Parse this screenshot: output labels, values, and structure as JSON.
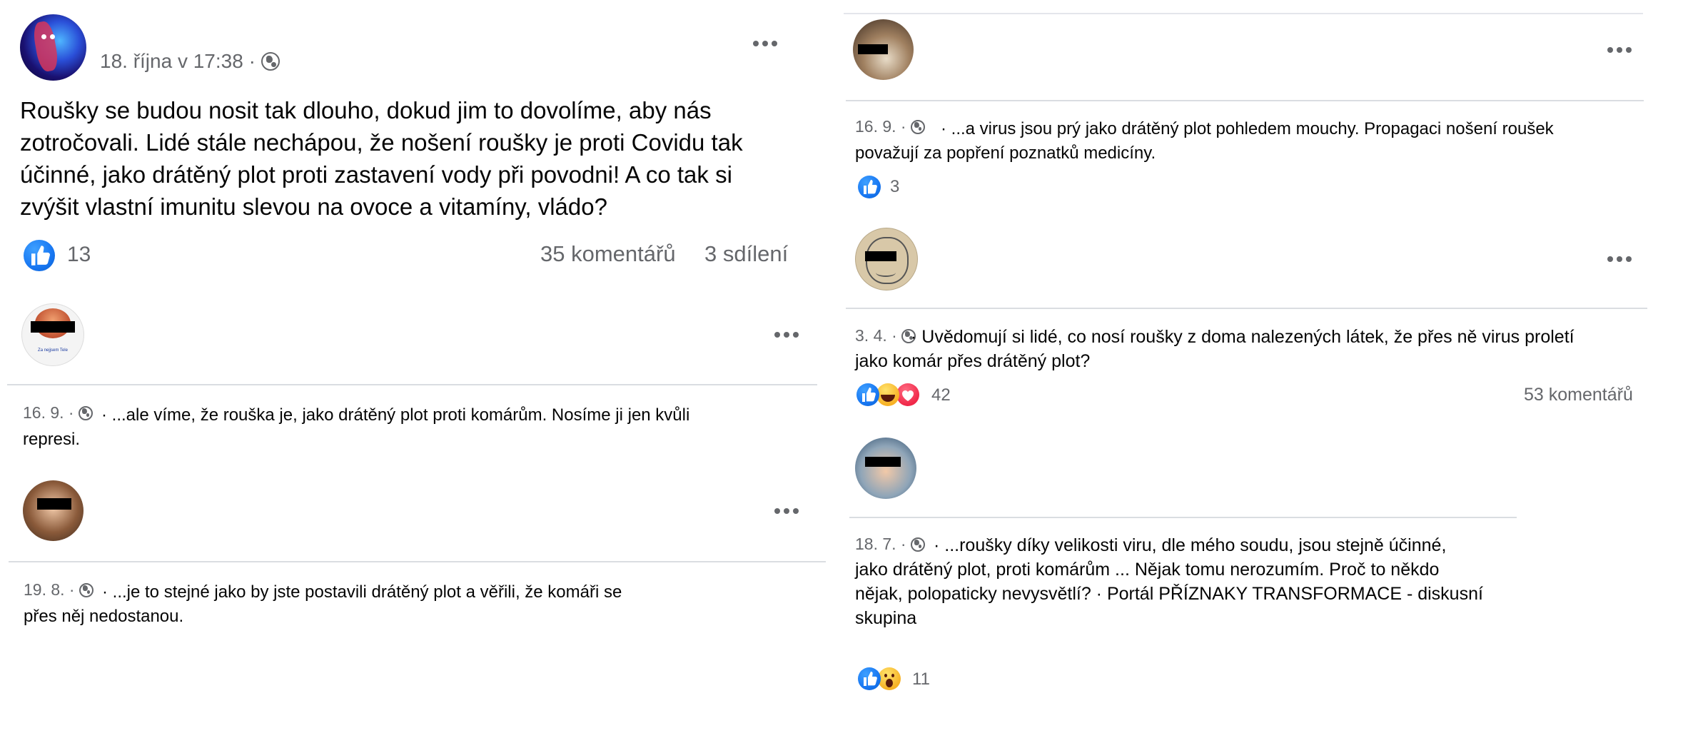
{
  "main_post": {
    "timestamp": "18. října v 17:38 ·",
    "text_lines": [
      "Roušky se budou nosit tak dlouho, dokud  jim to dovolíme, aby nás",
      "zotročovali. Lidé stále nechápou, že nošení roušky je proti Covidu tak",
      "účinné, jako drátěný plot proti zastavení vody při povodni! A co tak si",
      "zvýšit vlastní imunitu slevou na ovoce a vitamíny, vládo?"
    ],
    "likes": "13",
    "comments": "35 komentářů",
    "shares": "3 sdílení",
    "privacy_icon": "globe-icon",
    "more_icon": "more-dots-icon"
  },
  "left_posts": [
    {
      "avatar_caption": "Za nejjsem Tele",
      "timestamp": "16. 9. ·",
      "text_lines": [
        "· ...ale víme, že rouška je, jako drátěný plot proti komárům. Nosíme ji jen kvůli",
        "represi."
      ]
    },
    {
      "timestamp": "19. 8. ·",
      "text_lines": [
        "· ...je to stejné jako by jste postavili drátěný plot a věřili, že komáři se",
        "přes něj nedostanou."
      ]
    }
  ],
  "right_posts": [
    {
      "timestamp": "16. 9. ·",
      "text_lines": [
        "· ...a virus jsou prý jako drátěný plot pohledem mouchy. Propagaci nošení roušek",
        "považují za popření poznatků medicíny."
      ],
      "reactions": [
        "like"
      ],
      "count": "3"
    },
    {
      "timestamp": "3. 4. ·",
      "text_lines": [
        "· Uvědomují si lidé, co nosí roušky z doma nalezených látek, že přes ně virus proletí",
        "jako komár přes drátěný plot?"
      ],
      "reactions": [
        "like",
        "haha",
        "love"
      ],
      "count": "42",
      "comments": "53 komentářů"
    },
    {
      "timestamp": "18. 7. ·",
      "text_lines": [
        "· ...roušky díky velikosti viru, dle mého soudu, jsou stejně účinné,",
        "jako drátěný plot, proti komárům ... Nějak tomu nerozumím. Proč to někdo",
        "nějak, polopaticky nevysvětlí? · Portál PŘÍZNAKY TRANSFORMACE - diskusní",
        "skupina"
      ],
      "reactions": [
        "like",
        "wow"
      ],
      "count": "11"
    }
  ],
  "colors": {
    "text": "#050505",
    "meta": "#65676b",
    "like": "#1877f2",
    "divider": "#dadde1"
  }
}
